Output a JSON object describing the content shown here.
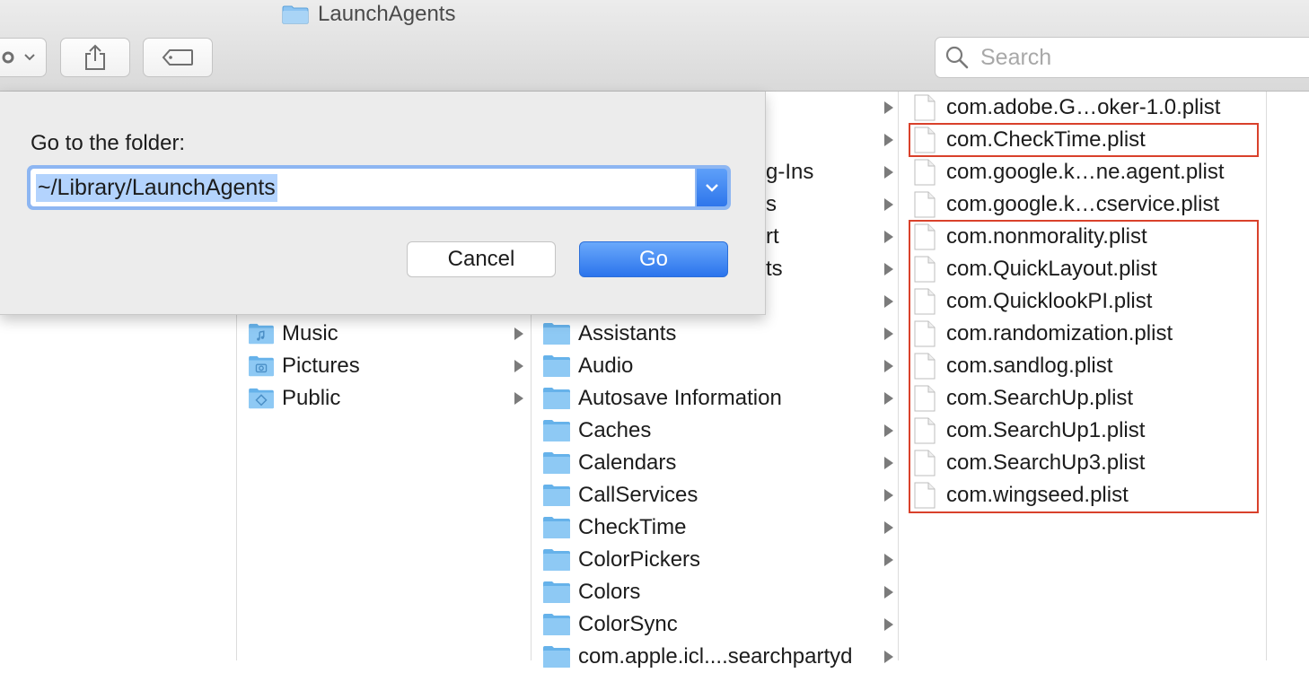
{
  "window": {
    "title": "LaunchAgents",
    "title_icon": "folder-icon"
  },
  "toolbar": {
    "action_icon": "gear-icon",
    "share_icon": "share-icon",
    "tags_icon": "tag-icon",
    "search": {
      "placeholder": "Search",
      "icon": "magnifier-icon"
    }
  },
  "columns": {
    "home": [
      {
        "label": "Music",
        "icon": "music-folder-icon"
      },
      {
        "label": "Pictures",
        "icon": "pictures-folder-icon"
      },
      {
        "label": "Public",
        "icon": "public-folder-icon"
      }
    ],
    "library_partial": [
      "g-Ins",
      "s",
      "rt",
      "ts"
    ],
    "library": [
      {
        "label": "Assistants"
      },
      {
        "label": "Audio"
      },
      {
        "label": "Autosave Information"
      },
      {
        "label": "Caches"
      },
      {
        "label": "Calendars"
      },
      {
        "label": "CallServices"
      },
      {
        "label": "CheckTime"
      },
      {
        "label": "ColorPickers"
      },
      {
        "label": "Colors"
      },
      {
        "label": "ColorSync"
      },
      {
        "label": "com.apple.icl....searchpartyd"
      }
    ],
    "launch_agents": [
      {
        "label": "com.adobe.G…oker-1.0.plist"
      },
      {
        "label": "com.CheckTime.plist"
      },
      {
        "label": "com.google.k…ne.agent.plist"
      },
      {
        "label": "com.google.k…cservice.plist"
      },
      {
        "label": "com.nonmorality.plist"
      },
      {
        "label": "com.QuickLayout.plist"
      },
      {
        "label": "com.QuicklookPI.plist"
      },
      {
        "label": "com.randomization.plist"
      },
      {
        "label": "com.sandlog.plist"
      },
      {
        "label": "com.SearchUp.plist"
      },
      {
        "label": "com.SearchUp1.plist"
      },
      {
        "label": "com.SearchUp3.plist"
      },
      {
        "label": "com.wingseed.plist"
      }
    ]
  },
  "goto_dialog": {
    "label": "Go to the folder:",
    "path_value": "~/Library/LaunchAgents",
    "cancel_label": "Cancel",
    "go_label": "Go"
  },
  "colors": {
    "accent": "#2e76eb",
    "highlight_box": "#d9412b",
    "selection": "#b3d3fd"
  }
}
